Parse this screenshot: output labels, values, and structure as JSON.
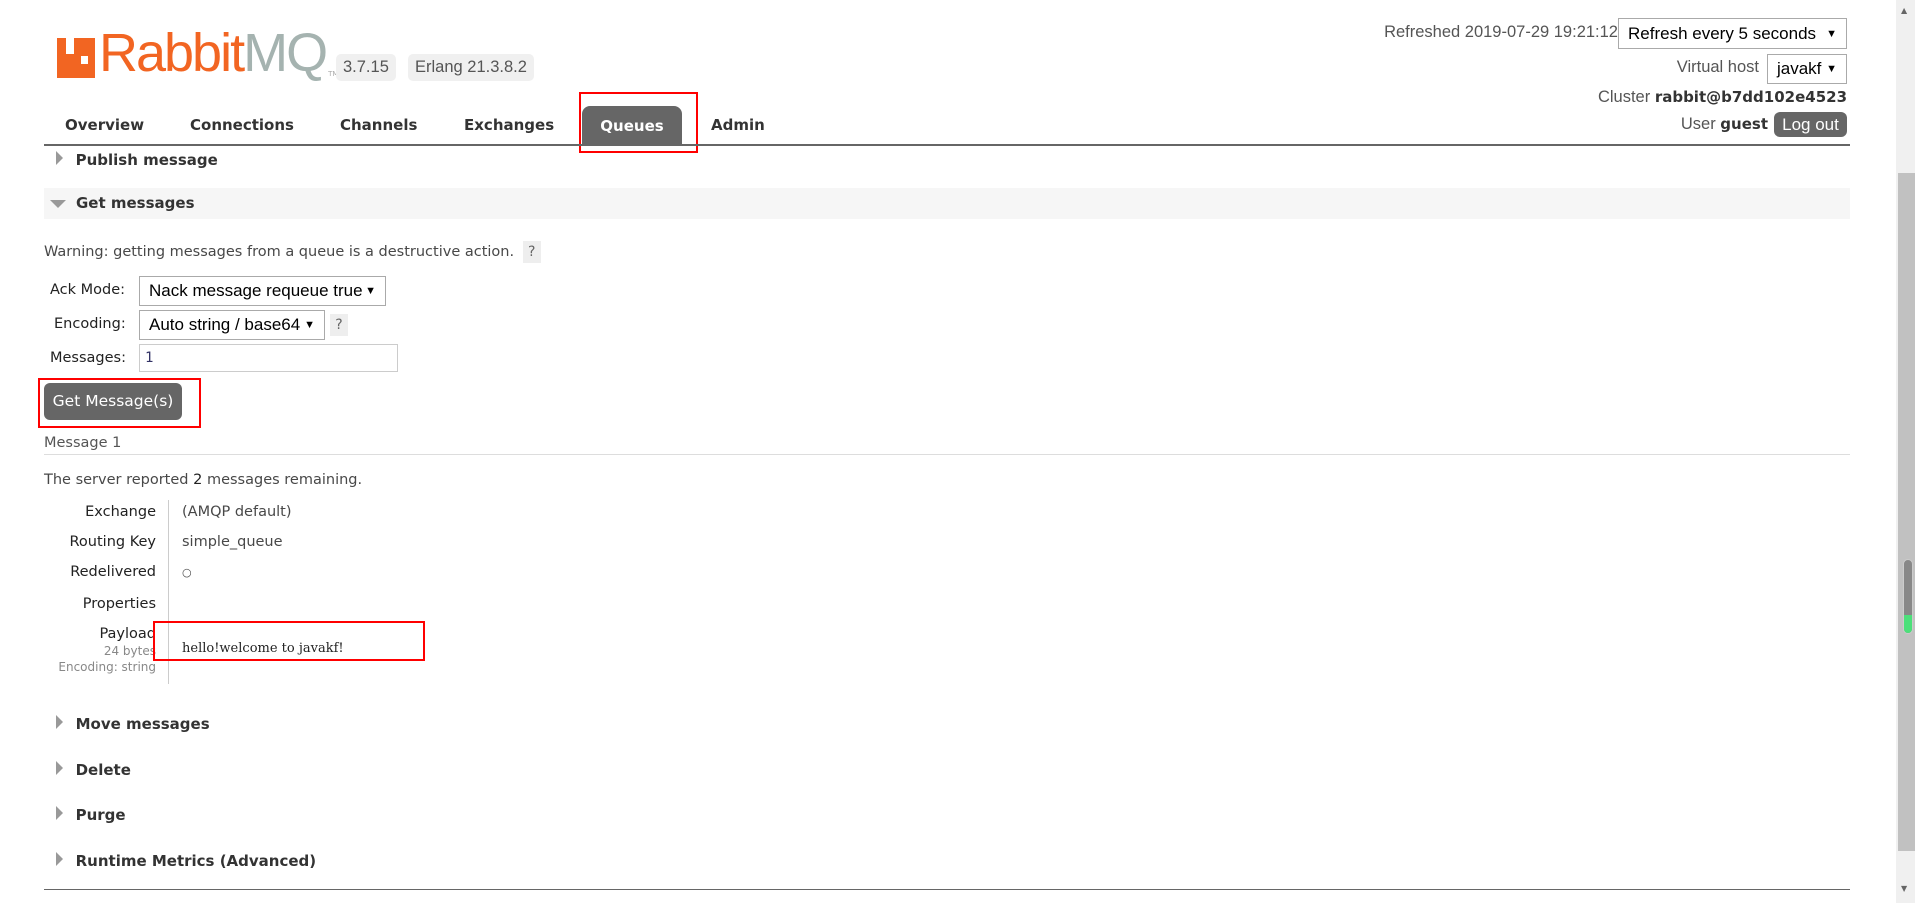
{
  "header": {
    "logo_text": "RabbitMQ",
    "version": "3.7.15",
    "erlang": "Erlang 21.3.8.2",
    "refreshed": "Refreshed 2019-07-29 19:21:12",
    "refresh_select": "Refresh every 5 seconds",
    "vhost_label": "Virtual host",
    "vhost_select": "javakf",
    "cluster_label": "Cluster",
    "cluster_name": "rabbit@b7dd102e4523",
    "user_label": "User",
    "user_name": "guest",
    "logout_label": "Log out"
  },
  "nav": {
    "tabs": [
      {
        "label": "Overview"
      },
      {
        "label": "Connections"
      },
      {
        "label": "Channels"
      },
      {
        "label": "Exchanges"
      },
      {
        "label": "Queues",
        "active": true
      },
      {
        "label": "Admin"
      }
    ]
  },
  "sections": {
    "publish": "Publish message",
    "get": "Get messages",
    "move": "Move messages",
    "delete": "Delete",
    "purge": "Purge",
    "runtime": "Runtime Metrics (Advanced)"
  },
  "get_form": {
    "warning": "Warning: getting messages from a queue is a destructive action.",
    "help": "?",
    "ack_label": "Ack Mode:",
    "ack_value": "Nack message requeue true",
    "encoding_label": "Encoding:",
    "encoding_value": "Auto string / base64",
    "messages_label": "Messages:",
    "messages_value": "1",
    "submit": "Get Message(s)"
  },
  "result": {
    "title": "Message 1",
    "remaining_pre": "The server reported ",
    "remaining_count": "2",
    "remaining_post": " messages remaining.",
    "rows": [
      {
        "label": "Exchange",
        "value": "(AMQP default)"
      },
      {
        "label": "Routing Key",
        "value": "simple_queue"
      },
      {
        "label": "Redelivered",
        "value": "○"
      },
      {
        "label": "Properties",
        "value": ""
      },
      {
        "label": "Payload",
        "value": "hello!welcome to javakf!"
      }
    ],
    "payload_size": "24 bytes",
    "payload_encoding": "Encoding: string"
  },
  "colors": {
    "accent": "#f26522",
    "highlight": "#ff0000",
    "tab_active": "#666666"
  }
}
